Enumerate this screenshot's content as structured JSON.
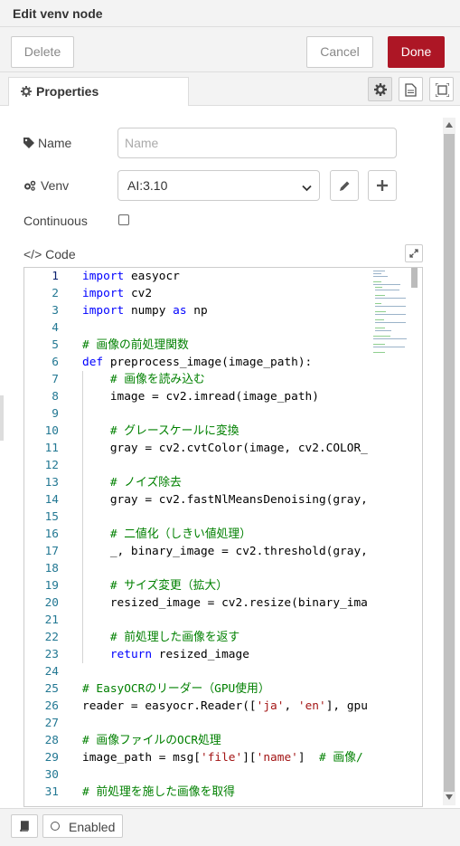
{
  "window": {
    "title": "Edit venv node"
  },
  "toolbar": {
    "delete_label": "Delete",
    "cancel_label": "Cancel",
    "done_label": "Done",
    "done_color": "#ad1625"
  },
  "tabs": {
    "properties_label": "Properties"
  },
  "form": {
    "name_label": "Name",
    "name_placeholder": "Name",
    "venv_label": "Venv",
    "venv_selected": "AI:3.10",
    "continuous_label": "Continuous",
    "continuous_checked": false,
    "code_label": "</> Code"
  },
  "code": {
    "lines": [
      {
        "n": "1",
        "t": "import easyocr"
      },
      {
        "n": "2",
        "t": "import cv2"
      },
      {
        "n": "3",
        "t": "import numpy as np"
      },
      {
        "n": "4",
        "t": ""
      },
      {
        "n": "5",
        "t": "# 画像の前処理関数"
      },
      {
        "n": "6",
        "t": "def preprocess_image(image_path):"
      },
      {
        "n": "7",
        "t": "    # 画像を読み込む"
      },
      {
        "n": "8",
        "t": "    image = cv2.imread(image_path)"
      },
      {
        "n": "9",
        "t": ""
      },
      {
        "n": "10",
        "t": "    # グレースケールに変換"
      },
      {
        "n": "11",
        "t": "    gray = cv2.cvtColor(image, cv2.COLOR_"
      },
      {
        "n": "12",
        "t": ""
      },
      {
        "n": "13",
        "t": "    # ノイズ除去"
      },
      {
        "n": "14",
        "t": "    gray = cv2.fastNlMeansDenoising(gray,"
      },
      {
        "n": "15",
        "t": ""
      },
      {
        "n": "16",
        "t": "    # 二値化（しきい値処理）"
      },
      {
        "n": "17",
        "t": "    _, binary_image = cv2.threshold(gray,"
      },
      {
        "n": "18",
        "t": ""
      },
      {
        "n": "19",
        "t": "    # サイズ変更（拡大）"
      },
      {
        "n": "20",
        "t": "    resized_image = cv2.resize(binary_ima"
      },
      {
        "n": "21",
        "t": ""
      },
      {
        "n": "22",
        "t": "    # 前処理した画像を返す"
      },
      {
        "n": "23",
        "t": "    return resized_image"
      },
      {
        "n": "24",
        "t": ""
      },
      {
        "n": "25",
        "t": "# EasyOCRのリーダー（GPU使用）"
      },
      {
        "n": "26",
        "t": "reader = easyocr.Reader(['ja', 'en'], gpu"
      },
      {
        "n": "27",
        "t": ""
      },
      {
        "n": "28",
        "t": "# 画像ファイルのOCR処理"
      },
      {
        "n": "29",
        "t": "image_path = msg['file']['name']  # 画像/"
      },
      {
        "n": "30",
        "t": ""
      },
      {
        "n": "31",
        "t": "# 前処理を施した画像を取得"
      }
    ]
  },
  "footer": {
    "enabled_label": "Enabled"
  },
  "icons": [
    "gear-icon",
    "info-icon",
    "expand-icon",
    "tag-icon",
    "cogs-icon",
    "pencil-icon",
    "plus-icon",
    "code-icon",
    "book-icon",
    "circle-icon",
    "chevron-down-icon"
  ]
}
